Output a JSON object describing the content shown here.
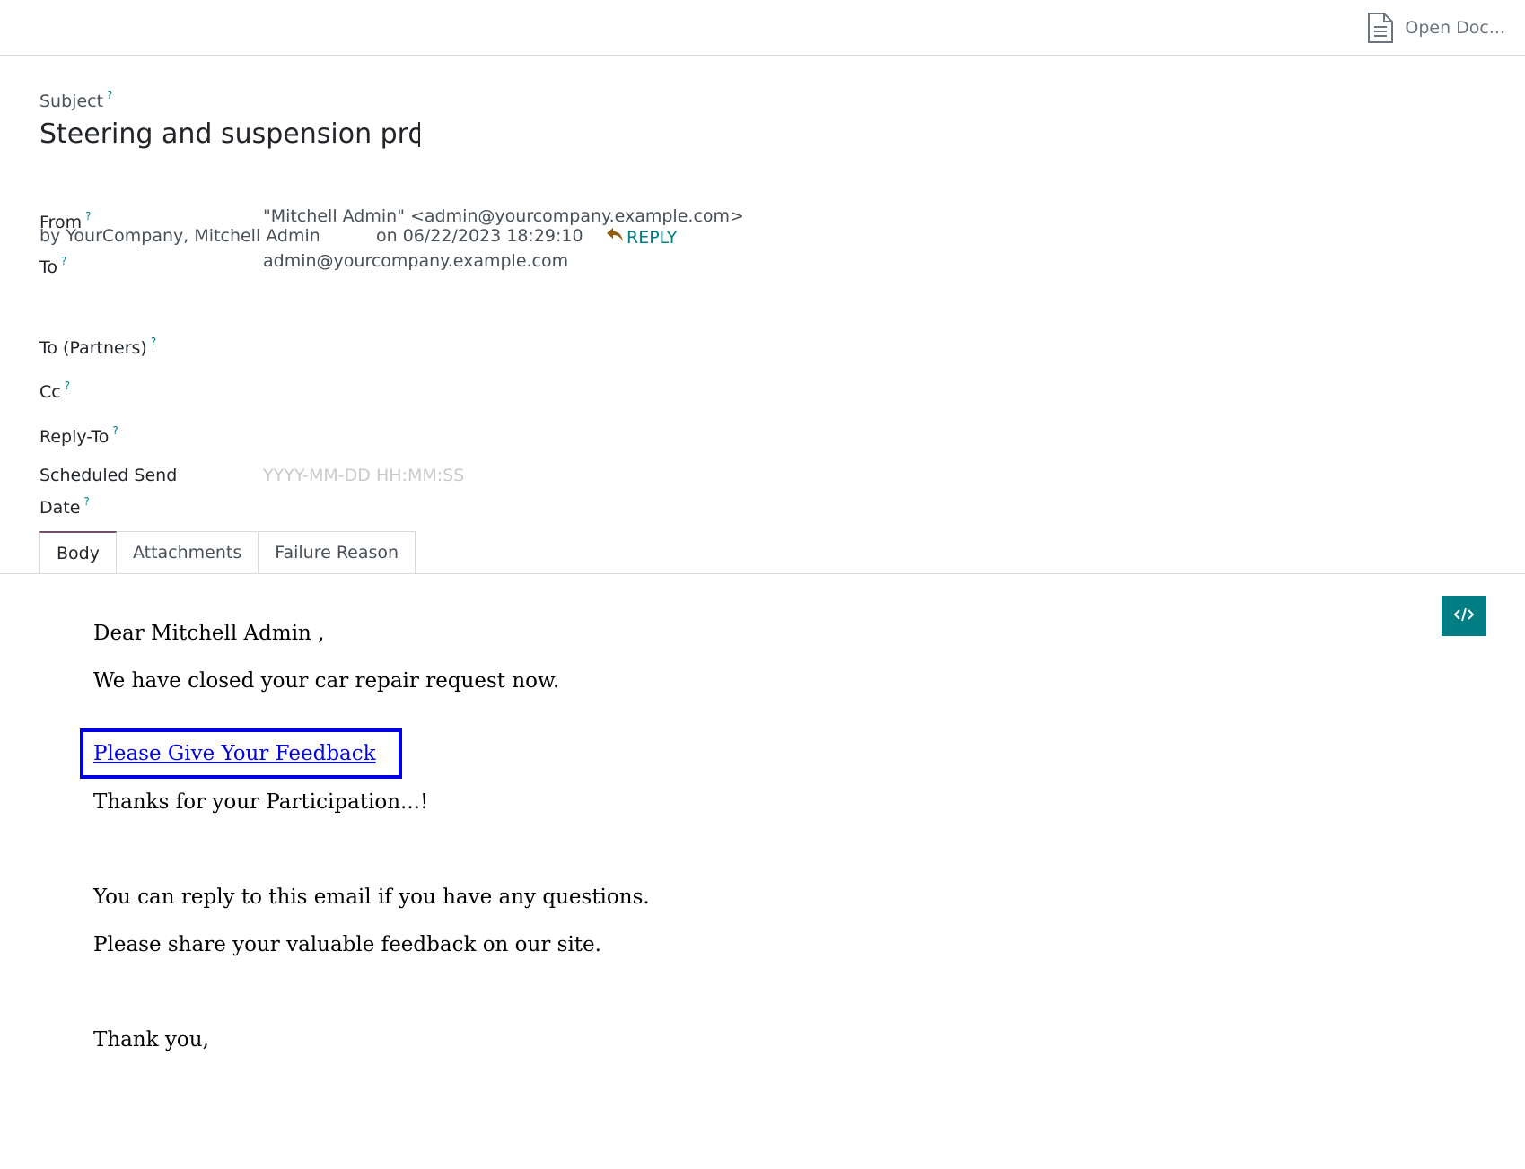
{
  "header": {
    "open_document_label": "Open Doc..."
  },
  "form": {
    "subject_label": "Subject",
    "help_marker": "?",
    "subject_value": "Steering and suspension problem",
    "byline_author": "by YourCompany, Mitchell Admin",
    "byline_date": "on 06/22/2023 18:29:10",
    "reply_label": "REPLY",
    "fields": {
      "from_label": "From",
      "from_value": "\"Mitchell Admin\" <admin@yourcompany.example.com>",
      "to_label": "To",
      "to_value": "admin@yourcompany.example.com",
      "to_partners_label": "To (Partners)",
      "cc_label": "Cc",
      "reply_to_label": "Reply-To",
      "scheduled_label_line1": "Scheduled Send",
      "scheduled_label_line2": "Date",
      "scheduled_placeholder": "YYYY-MM-DD HH:MM:SS"
    }
  },
  "tabs": [
    {
      "label": "Body",
      "active": true
    },
    {
      "label": "Attachments",
      "active": false
    },
    {
      "label": "Failure Reason",
      "active": false
    }
  ],
  "body": {
    "greeting": "Dear Mitchell Admin ,",
    "line1": "We have closed your car repair request now.",
    "feedback_link": "Please Give Your Feedback",
    "thanks_participation": "Thanks for your Participation...!",
    "reply_note": "You can reply to this email if you have any questions.",
    "share_note": "Please share your valuable feedback on our site.",
    "signoff": "Thank you,"
  },
  "colors": {
    "accent": "#017e84",
    "reply_icon": "#8f5d12",
    "highlight": "#0000e6",
    "link": "#0000ee"
  },
  "icons": {
    "open_document": "document-icon",
    "reply": "reply-arrow-icon",
    "code_view": "code-icon"
  }
}
